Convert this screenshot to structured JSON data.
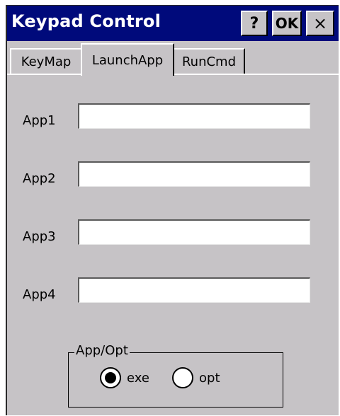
{
  "window": {
    "title": "Keypad Control",
    "help_label": "?",
    "ok_label": "OK",
    "close_label": "×"
  },
  "tabs": [
    {
      "label": "KeyMap",
      "selected": false
    },
    {
      "label": "LaunchApp",
      "selected": true
    },
    {
      "label": "RunCmd",
      "selected": false
    }
  ],
  "apps": [
    {
      "label": "App1",
      "value": ""
    },
    {
      "label": "App2",
      "value": ""
    },
    {
      "label": "App3",
      "value": ""
    },
    {
      "label": "App4",
      "value": ""
    }
  ],
  "app_opt": {
    "title": "App/Opt",
    "options": [
      {
        "label": "exe",
        "checked": true
      },
      {
        "label": "opt",
        "checked": false
      }
    ]
  },
  "colors": {
    "titlebar": "#000a7b",
    "face": "#c6c3c6",
    "field": "#ffffff"
  }
}
